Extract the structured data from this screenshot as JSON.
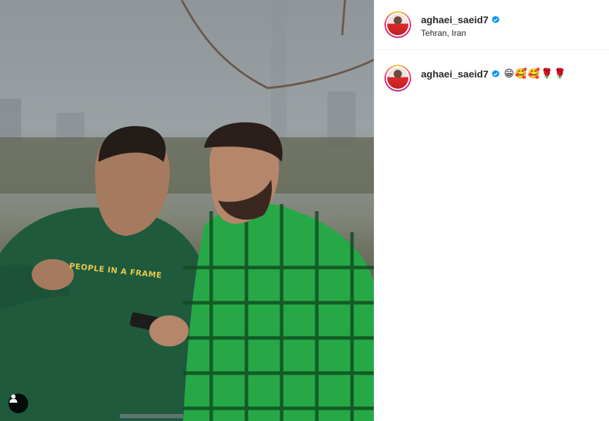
{
  "post": {
    "author": {
      "username": "aghaei_saeid7",
      "verified": true,
      "location": "Tehran, Iran"
    },
    "caption": {
      "username": "aghaei_saeid7",
      "text": "😁🥰🥰🌹🌹"
    },
    "photo": {
      "shirt_print": "PEOPLE IN A FRAME"
    }
  },
  "colors": {
    "verified_badge": "#0095f6",
    "story_ring": [
      "#f9ce34",
      "#ee2a7b",
      "#6228d7"
    ],
    "divider": "#efefef"
  },
  "icons": {
    "tag": "user-tag-icon",
    "verified": "verified-badge-icon"
  }
}
